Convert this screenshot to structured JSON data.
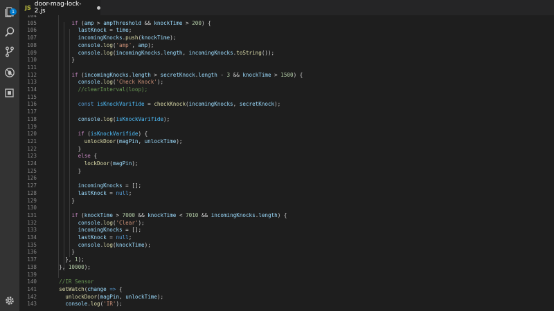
{
  "window": {
    "title": "door-mag-lock-2.js"
  },
  "activity_bar": {
    "items": [
      {
        "name": "explorer-icon",
        "badge": "1"
      },
      {
        "name": "search-icon"
      },
      {
        "name": "source-control-icon"
      },
      {
        "name": "debug-icon"
      },
      {
        "name": "extensions-icon"
      }
    ],
    "bottom": [
      {
        "name": "gear-icon"
      }
    ]
  },
  "tabs": [
    {
      "language": "JS",
      "label": "door-mag-lock-2.js",
      "dirty": true
    }
  ],
  "colors": {
    "background": "#1e1e1e",
    "activity_bar": "#333333",
    "tab_bar": "#252526",
    "keyword": "#569cd6",
    "control": "#c586c0",
    "function": "#dcdcaa",
    "variable": "#9cdcfe",
    "string": "#ce9178",
    "number": "#b5cea8",
    "comment": "#6a9955"
  },
  "editor": {
    "lines": [
      {
        "n": "104",
        "tokens": [
          [
            "",
            ""
          ]
        ]
      },
      {
        "n": "105",
        "tokens": [
          [
            "      ",
            ""
          ],
          [
            "if",
            "cf"
          ],
          [
            " (",
            ""
          ],
          [
            "amp",
            "v"
          ],
          [
            " > ",
            ""
          ],
          [
            "ampThreshold",
            "v"
          ],
          [
            " && ",
            ""
          ],
          [
            "knockTime",
            "v"
          ],
          [
            " > ",
            ""
          ],
          [
            "200",
            "n"
          ],
          [
            ") {",
            ""
          ]
        ]
      },
      {
        "n": "106",
        "tokens": [
          [
            "        ",
            ""
          ],
          [
            "lastKnock",
            "v"
          ],
          [
            " = ",
            ""
          ],
          [
            "time",
            "v"
          ],
          [
            ";",
            ""
          ]
        ]
      },
      {
        "n": "107",
        "tokens": [
          [
            "        ",
            ""
          ],
          [
            "incomingKnocks",
            "v"
          ],
          [
            ".",
            ""
          ],
          [
            "push",
            "f"
          ],
          [
            "(",
            ""
          ],
          [
            "knockTime",
            "v"
          ],
          [
            ");",
            ""
          ]
        ]
      },
      {
        "n": "108",
        "tokens": [
          [
            "        ",
            ""
          ],
          [
            "console",
            "v"
          ],
          [
            ".",
            ""
          ],
          [
            "log",
            "f"
          ],
          [
            "(",
            ""
          ],
          [
            "'amp'",
            "s"
          ],
          [
            ", ",
            ""
          ],
          [
            "amp",
            "v"
          ],
          [
            ");",
            ""
          ]
        ]
      },
      {
        "n": "109",
        "tokens": [
          [
            "        ",
            ""
          ],
          [
            "console",
            "v"
          ],
          [
            ".",
            ""
          ],
          [
            "log",
            "f"
          ],
          [
            "(",
            ""
          ],
          [
            "incomingKnocks",
            "v"
          ],
          [
            ".",
            ""
          ],
          [
            "length",
            "v"
          ],
          [
            ", ",
            ""
          ],
          [
            "incomingKnocks",
            "v"
          ],
          [
            ".",
            ""
          ],
          [
            "toString",
            "f"
          ],
          [
            "());",
            ""
          ]
        ]
      },
      {
        "n": "110",
        "tokens": [
          [
            "      }",
            ""
          ]
        ]
      },
      {
        "n": "111",
        "tokens": [
          [
            "",
            ""
          ]
        ]
      },
      {
        "n": "112",
        "tokens": [
          [
            "      ",
            ""
          ],
          [
            "if",
            "cf"
          ],
          [
            " (",
            ""
          ],
          [
            "incomingKnocks",
            "v"
          ],
          [
            ".",
            ""
          ],
          [
            "length",
            "v"
          ],
          [
            " > ",
            ""
          ],
          [
            "secretKnock",
            "v"
          ],
          [
            ".",
            ""
          ],
          [
            "length",
            "v"
          ],
          [
            " - ",
            ""
          ],
          [
            "3",
            "n"
          ],
          [
            " && ",
            ""
          ],
          [
            "knockTime",
            "v"
          ],
          [
            " > ",
            ""
          ],
          [
            "1500",
            "n"
          ],
          [
            ") {",
            ""
          ]
        ]
      },
      {
        "n": "113",
        "tokens": [
          [
            "        ",
            ""
          ],
          [
            "console",
            "v"
          ],
          [
            ".",
            ""
          ],
          [
            "log",
            "f"
          ],
          [
            "(",
            ""
          ],
          [
            "'Check Knock'",
            "s"
          ],
          [
            ");",
            ""
          ]
        ]
      },
      {
        "n": "114",
        "tokens": [
          [
            "        ",
            ""
          ],
          [
            "//clearInterval(loop);",
            "c"
          ]
        ]
      },
      {
        "n": "115",
        "tokens": [
          [
            "",
            ""
          ]
        ]
      },
      {
        "n": "116",
        "tokens": [
          [
            "        ",
            ""
          ],
          [
            "const",
            "k"
          ],
          [
            " ",
            ""
          ],
          [
            "isKnockVarifide",
            "cls"
          ],
          [
            " = ",
            ""
          ],
          [
            "checkKnock",
            "f"
          ],
          [
            "(",
            ""
          ],
          [
            "incomingKnocks",
            "v"
          ],
          [
            ", ",
            ""
          ],
          [
            "secretKnock",
            "v"
          ],
          [
            ");",
            ""
          ]
        ]
      },
      {
        "n": "117",
        "tokens": [
          [
            "",
            ""
          ]
        ]
      },
      {
        "n": "118",
        "tokens": [
          [
            "        ",
            ""
          ],
          [
            "console",
            "v"
          ],
          [
            ".",
            ""
          ],
          [
            "log",
            "f"
          ],
          [
            "(",
            ""
          ],
          [
            "isKnockVarifide",
            "cls"
          ],
          [
            ");",
            ""
          ]
        ]
      },
      {
        "n": "119",
        "tokens": [
          [
            "",
            ""
          ]
        ]
      },
      {
        "n": "120",
        "tokens": [
          [
            "        ",
            ""
          ],
          [
            "if",
            "cf"
          ],
          [
            " (",
            ""
          ],
          [
            "isKnockVarifide",
            "cls"
          ],
          [
            ") {",
            ""
          ]
        ]
      },
      {
        "n": "121",
        "tokens": [
          [
            "          ",
            ""
          ],
          [
            "unlockDoor",
            "f"
          ],
          [
            "(",
            ""
          ],
          [
            "magPin",
            "v"
          ],
          [
            ", ",
            ""
          ],
          [
            "unlockTime",
            "v"
          ],
          [
            ");",
            ""
          ]
        ]
      },
      {
        "n": "122",
        "tokens": [
          [
            "        }",
            ""
          ]
        ]
      },
      {
        "n": "123",
        "tokens": [
          [
            "        ",
            ""
          ],
          [
            "else",
            "cf"
          ],
          [
            " {",
            ""
          ]
        ]
      },
      {
        "n": "124",
        "tokens": [
          [
            "          ",
            ""
          ],
          [
            "lockDoor",
            "f"
          ],
          [
            "(",
            ""
          ],
          [
            "magPin",
            "v"
          ],
          [
            ");",
            ""
          ]
        ]
      },
      {
        "n": "125",
        "tokens": [
          [
            "        }",
            ""
          ]
        ]
      },
      {
        "n": "126",
        "tokens": [
          [
            "",
            ""
          ]
        ]
      },
      {
        "n": "127",
        "tokens": [
          [
            "        ",
            ""
          ],
          [
            "incomingKnocks",
            "v"
          ],
          [
            " = [];",
            ""
          ]
        ]
      },
      {
        "n": "128",
        "tokens": [
          [
            "        ",
            ""
          ],
          [
            "lastKnock",
            "v"
          ],
          [
            " = ",
            ""
          ],
          [
            "null",
            "k"
          ],
          [
            ";",
            ""
          ]
        ]
      },
      {
        "n": "129",
        "tokens": [
          [
            "      }",
            ""
          ]
        ]
      },
      {
        "n": "130",
        "tokens": [
          [
            "",
            ""
          ]
        ]
      },
      {
        "n": "131",
        "tokens": [
          [
            "      ",
            ""
          ],
          [
            "if",
            "cf"
          ],
          [
            " (",
            ""
          ],
          [
            "knockTime",
            "v"
          ],
          [
            " > ",
            ""
          ],
          [
            "7000",
            "n"
          ],
          [
            " && ",
            ""
          ],
          [
            "knockTime",
            "v"
          ],
          [
            " < ",
            ""
          ],
          [
            "7010",
            "n"
          ],
          [
            " && ",
            ""
          ],
          [
            "incomingKnocks",
            "v"
          ],
          [
            ".",
            ""
          ],
          [
            "length",
            "v"
          ],
          [
            ") {",
            ""
          ]
        ]
      },
      {
        "n": "132",
        "tokens": [
          [
            "        ",
            ""
          ],
          [
            "console",
            "v"
          ],
          [
            ".",
            ""
          ],
          [
            "log",
            "f"
          ],
          [
            "(",
            ""
          ],
          [
            "'Clear'",
            "s"
          ],
          [
            ");",
            ""
          ]
        ]
      },
      {
        "n": "133",
        "tokens": [
          [
            "        ",
            ""
          ],
          [
            "incomingKnocks",
            "v"
          ],
          [
            " = [];",
            ""
          ]
        ]
      },
      {
        "n": "134",
        "tokens": [
          [
            "        ",
            ""
          ],
          [
            "lastKnock",
            "v"
          ],
          [
            " = ",
            ""
          ],
          [
            "null",
            "k"
          ],
          [
            ";",
            ""
          ]
        ]
      },
      {
        "n": "135",
        "tokens": [
          [
            "        ",
            ""
          ],
          [
            "console",
            "v"
          ],
          [
            ".",
            ""
          ],
          [
            "log",
            "f"
          ],
          [
            "(",
            ""
          ],
          [
            "knockTime",
            "v"
          ],
          [
            ");",
            ""
          ]
        ]
      },
      {
        "n": "136",
        "tokens": [
          [
            "      }",
            ""
          ]
        ]
      },
      {
        "n": "137",
        "tokens": [
          [
            "    }, ",
            ""
          ],
          [
            "1",
            "n"
          ],
          [
            ");",
            ""
          ]
        ]
      },
      {
        "n": "138",
        "tokens": [
          [
            "  }, ",
            ""
          ],
          [
            "10000",
            "n"
          ],
          [
            ");",
            ""
          ]
        ]
      },
      {
        "n": "139",
        "tokens": [
          [
            "",
            ""
          ]
        ]
      },
      {
        "n": "140",
        "tokens": [
          [
            "  ",
            ""
          ],
          [
            "//IR Sensor",
            "c"
          ]
        ]
      },
      {
        "n": "141",
        "tokens": [
          [
            "  ",
            ""
          ],
          [
            "setWatch",
            "f"
          ],
          [
            "(",
            ""
          ],
          [
            "change",
            "v"
          ],
          [
            " ",
            ""
          ],
          [
            "=>",
            "k"
          ],
          [
            " {",
            ""
          ]
        ]
      },
      {
        "n": "142",
        "tokens": [
          [
            "    ",
            ""
          ],
          [
            "unlockDoor",
            "f"
          ],
          [
            "(",
            ""
          ],
          [
            "magPin",
            "v"
          ],
          [
            ", ",
            ""
          ],
          [
            "unlockTime",
            "v"
          ],
          [
            ");",
            ""
          ]
        ]
      },
      {
        "n": "143",
        "tokens": [
          [
            "    ",
            ""
          ],
          [
            "console",
            "v"
          ],
          [
            ".",
            ""
          ],
          [
            "log",
            "f"
          ],
          [
            "(",
            ""
          ],
          [
            "'IR'",
            "s"
          ],
          [
            ");",
            ""
          ]
        ]
      }
    ]
  }
}
